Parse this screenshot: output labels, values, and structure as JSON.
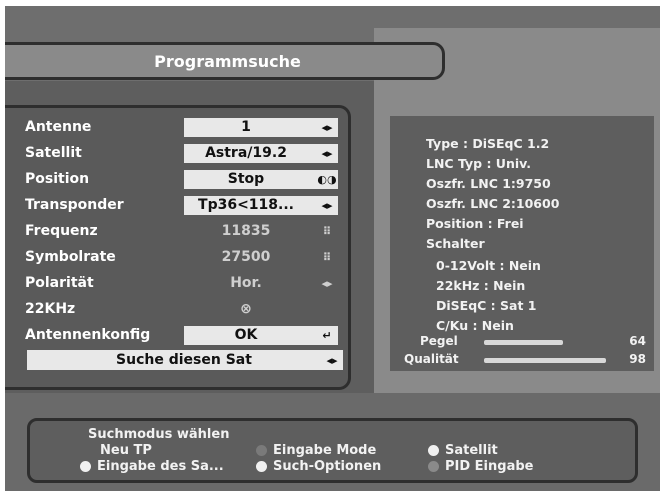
{
  "title": "Programmsuche",
  "settings": [
    {
      "label": "Antenne",
      "value": "1",
      "icon": "◂▸",
      "style": "box"
    },
    {
      "label": "Satellit",
      "value": "Astra/19.2",
      "icon": "◂▸",
      "style": "box"
    },
    {
      "label": "Position",
      "value": "Stop",
      "icon": "◐◑",
      "style": "box"
    },
    {
      "label": "Transponder",
      "value": "Tp36<118...",
      "icon": "◂▸",
      "style": "box"
    },
    {
      "label": "Frequenz",
      "value": "11835",
      "icon": "⠿",
      "style": "plain"
    },
    {
      "label": "Symbolrate",
      "value": "27500",
      "icon": "⠿",
      "style": "plain"
    },
    {
      "label": "Polarität",
      "value": "Hor.",
      "icon": "◂▸",
      "style": "plain"
    },
    {
      "label": "22KHz",
      "value": "⊗",
      "icon": "",
      "style": "plain"
    },
    {
      "label": "Antennenkonfig",
      "value": "OK",
      "icon": "↵",
      "style": "box"
    }
  ],
  "search_button": {
    "label": "Suche diesen Sat",
    "icon": "◂▸"
  },
  "info": {
    "type": "Type : DiSEqC 1.2",
    "lnc_type": "LNC Typ : Univ.",
    "lnc1": "Oszfr. LNC 1:9750",
    "lnc2": "Oszfr. LNC 2:10600",
    "position": "Position : Frei",
    "switch_heading": "Schalter",
    "v012": "0-12Volt : Nein",
    "khz22": "22kHz : Nein",
    "diseqc": "DiSEqC : Sat 1",
    "cku": "C/Ku : Nein"
  },
  "meters": {
    "pegel": {
      "label": "Pegel",
      "value": "64",
      "level": 0.64
    },
    "qualitaet": {
      "label": "Qualität",
      "value": "98",
      "level": 0.98
    }
  },
  "help": {
    "heading": "Suchmodus wählen",
    "items": [
      {
        "label": "Neu TP",
        "color": ""
      },
      {
        "label": "Eingabe Mode",
        "color": "#7a7a7a"
      },
      {
        "label": "Satellit",
        "color": "#f0f0f0"
      },
      {
        "label": "Eingabe des Sa...",
        "color": "#f0f0f0"
      },
      {
        "label": "Such-Optionen",
        "color": "#f0f0f0"
      },
      {
        "label": "PID Eingabe",
        "color": "#8a8a8a"
      }
    ]
  }
}
